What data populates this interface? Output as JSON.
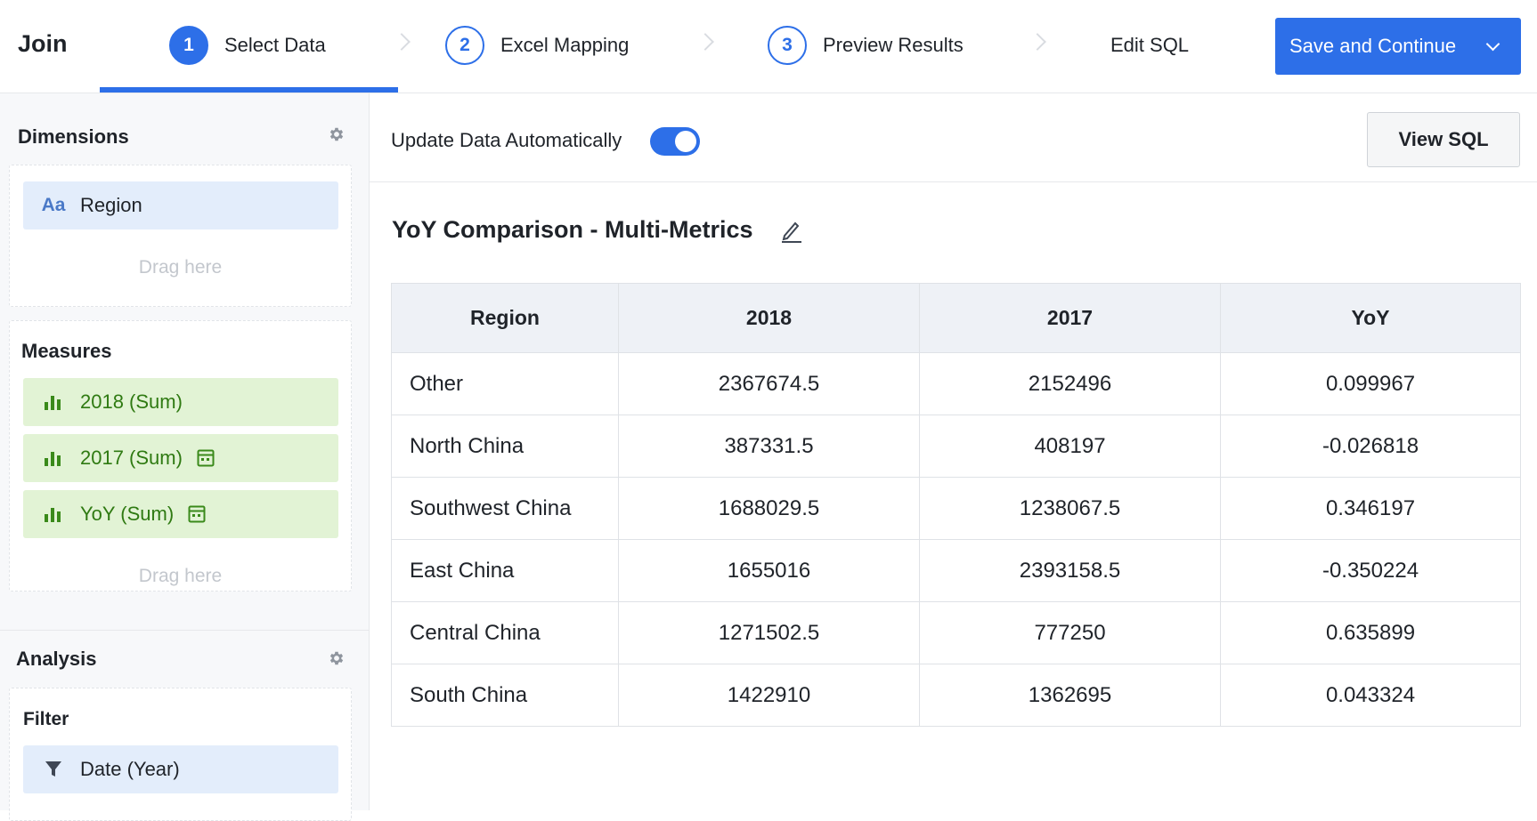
{
  "header": {
    "brand": "Join",
    "steps": [
      {
        "number": "1",
        "label": "Select Data"
      },
      {
        "number": "2",
        "label": "Excel Mapping"
      },
      {
        "number": "3",
        "label": "Preview Results"
      },
      {
        "number": "",
        "label": "Edit SQL"
      }
    ],
    "save_label": "Save and Continue"
  },
  "sidebar": {
    "dimensions_title": "Dimensions",
    "dimensions": [
      {
        "label": "Region",
        "icon": "Aa"
      }
    ],
    "drag_here": "Drag here",
    "measures_title": "Measures",
    "measures": [
      {
        "label": "2018 (Sum)"
      },
      {
        "label": "2017 (Sum)"
      },
      {
        "label": "YoY (Sum)"
      }
    ],
    "analysis_title": "Analysis",
    "filter_title": "Filter",
    "filters": [
      {
        "label": "Date (Year)"
      }
    ]
  },
  "toolbar": {
    "auto_update_label": "Update Data Automatically",
    "auto_update_on": true,
    "view_sql_label": "View SQL"
  },
  "chart": {
    "title": "YoY Comparison - Multi-Metrics"
  },
  "table": {
    "columns": [
      "Region",
      "2018",
      "2017",
      "YoY"
    ],
    "rows": [
      [
        "Other",
        "2367674.5",
        "2152496",
        "0.099967"
      ],
      [
        "North China",
        "387331.5",
        "408197",
        "-0.026818"
      ],
      [
        "Southwest China",
        "1688029.5",
        "1238067.5",
        "0.346197"
      ],
      [
        "East China",
        "1655016",
        "2393158.5",
        "-0.350224"
      ],
      [
        "Central China",
        "1271502.5",
        "777250",
        "0.635899"
      ],
      [
        "South China",
        "1422910",
        "1362695",
        "0.043324"
      ]
    ]
  },
  "colors": {
    "accent": "#2d6fe8",
    "measure_bg": "#e2f3d5",
    "measure_text": "#2f7a12",
    "dimension_bg": "#e3edfb"
  }
}
